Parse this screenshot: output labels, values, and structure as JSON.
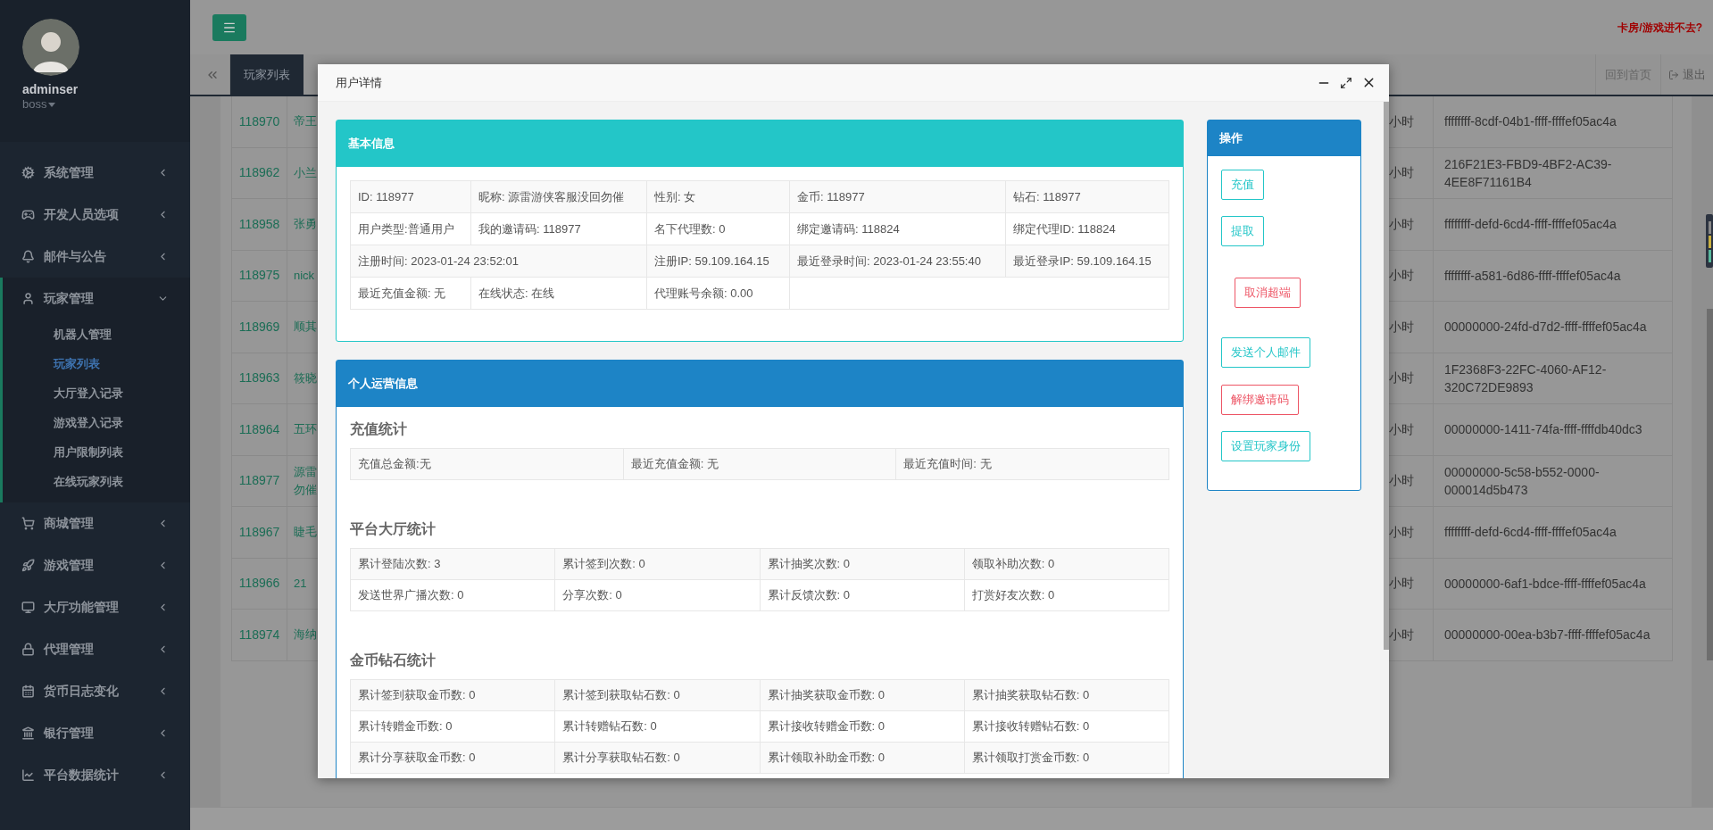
{
  "sidebar": {
    "user": {
      "name": "adminser",
      "role": "boss"
    },
    "menu": [
      {
        "label": "系统管理",
        "expanded": false
      },
      {
        "label": "开发人员选项",
        "expanded": false
      },
      {
        "label": "邮件与公告",
        "expanded": false
      },
      {
        "label": "玩家管理",
        "expanded": true,
        "children": [
          {
            "label": "机器人管理",
            "selected": false
          },
          {
            "label": "玩家列表",
            "selected": true
          },
          {
            "label": "大厅登入记录",
            "selected": false
          },
          {
            "label": "游戏登入记录",
            "selected": false
          },
          {
            "label": "用户限制列表",
            "selected": false
          },
          {
            "label": "在线玩家列表",
            "selected": false
          }
        ]
      },
      {
        "label": "商城管理",
        "expanded": false
      },
      {
        "label": "游戏管理",
        "expanded": false
      },
      {
        "label": "大厅功能管理",
        "expanded": false
      },
      {
        "label": "代理管理",
        "expanded": false
      },
      {
        "label": "货币日志变化",
        "expanded": false
      },
      {
        "label": "银行管理",
        "expanded": false
      },
      {
        "label": "平台数据统计",
        "expanded": false
      }
    ]
  },
  "header": {
    "alert_link": "卡房/游戏进不去?"
  },
  "tab_bar": {
    "tabs": [
      {
        "label": "玩家列表",
        "selected": true
      }
    ],
    "home": "回到首页",
    "logout": "退出"
  },
  "table": {
    "rows": [
      {
        "id": "118970",
        "name": [
          "帝王"
        ],
        "column_3": "小时",
        "column_4": "ffffffff-8cdf-04b1-ffff-ffffef05ac4a"
      },
      {
        "id": "118962",
        "name": [
          "小兰"
        ],
        "column_3": "小时",
        "column_4": "216F21E3-FBD9-4BF2-AC39-4EE8F71161B4"
      },
      {
        "id": "118958",
        "name": [
          "张勇"
        ],
        "column_3": "小时",
        "column_4": "ffffffff-defd-6cd4-ffff-ffffef05ac4a"
      },
      {
        "id": "118975",
        "name": [
          "nick"
        ],
        "column_3": "小时",
        "column_4": "ffffffff-a581-6d86-ffff-ffffef05ac4a"
      },
      {
        "id": "118969",
        "name": [
          "顺其"
        ],
        "column_3": "小时",
        "column_4": "00000000-24fd-d7d2-ffff-ffffef05ac4a"
      },
      {
        "id": "118963",
        "name": [
          "筱晓"
        ],
        "column_3": "小时",
        "column_4": "1F2368F3-22FC-4060-AF12-320C72DE9893"
      },
      {
        "id": "118964",
        "name": [
          "五环"
        ],
        "column_3": "小时",
        "column_4": "00000000-1411-74fa-ffff-ffffdb40dc3"
      },
      {
        "id": "118977",
        "name": [
          "源雷",
          "勿催"
        ],
        "column_3": "小时",
        "column_4": "00000000-5c58-b552-0000-000014d5b473"
      },
      {
        "id": "118967",
        "name": [
          "睫毛"
        ],
        "column_3": "小时",
        "column_4": "ffffffff-defd-6cd4-ffff-ffffef05ac4a"
      },
      {
        "id": "118966",
        "name": [
          "21"
        ],
        "column_3": "小时",
        "column_4": "00000000-6af1-bdce-ffff-ffffef05ac4a"
      },
      {
        "id": "118974",
        "name": [
          "海纳"
        ],
        "column_3": "小时",
        "column_4": "00000000-00ea-b3b7-ffff-ffffef05ac4a"
      }
    ]
  },
  "modal": {
    "title": "用户详情",
    "basic_info": {
      "title": "基本信息",
      "rows": [
        [
          {
            "text": "ID: 118977"
          },
          {
            "text": "昵称: 源雷游侠客服没回勿催"
          },
          {
            "text": "性别: 女"
          },
          {
            "text": "金币: 118977"
          },
          {
            "text": "钻石: 118977"
          }
        ],
        [
          {
            "text": "用户类型:普通用户"
          },
          {
            "text": "我的邀请码: 118977"
          },
          {
            "text": "名下代理数: 0"
          },
          {
            "text": "绑定邀请码: 118824"
          },
          {
            "text": "绑定代理ID: 118824"
          }
        ],
        [
          {
            "text": "注册时间: 2023-01-24 23:52:01",
            "colspan": 2
          },
          {
            "text": "注册IP: 59.109.164.15"
          },
          {
            "text": "最近登录时间: 2023-01-24 23:55:40"
          },
          {
            "text": "最近登录IP: 59.109.164.15"
          }
        ],
        [
          {
            "text": "最近充值金额: 无"
          },
          {
            "text": "在线状态: 在线"
          },
          {
            "text": "代理账号余额: 0.00"
          }
        ]
      ]
    },
    "operations": {
      "title": "个人运营信息",
      "sections": [
        {
          "title": "充值统计",
          "rows": [
            [
              "充值总金额:无",
              "最近充值金额: 无",
              "最近充值时间: 无"
            ]
          ]
        },
        {
          "title": "平台大厅统计",
          "rows": [
            [
              "累计登陆次数: 3",
              "累计签到次数: 0",
              "累计抽奖次数: 0",
              "领取补助次数: 0"
            ],
            [
              "发送世界广播次数: 0",
              "分享次数: 0",
              "累计反馈次数: 0",
              "打赏好友次数: 0"
            ]
          ]
        },
        {
          "title": "金币钻石统计",
          "rows": [
            [
              "累计签到获取金币数: 0",
              "累计签到获取钻石数: 0",
              "累计抽奖获取金币数: 0",
              "累计抽奖获取钻石数: 0"
            ],
            [
              "累计转赠金币数: 0",
              "累计转赠钻石数: 0",
              "累计接收转赠金币数: 0",
              "累计接收转赠钻石数: 0"
            ],
            [
              "累计分享获取金币数: 0",
              "累计分享获取钻石数: 0",
              "累计领取补助金币数: 0",
              "累计领取打赏金币数: 0"
            ]
          ]
        }
      ]
    },
    "actions": {
      "title": "操作",
      "buttons": [
        {
          "label": "充值",
          "kind": "info"
        },
        {
          "label": "提取",
          "kind": "info"
        },
        {
          "label": "取消超端",
          "kind": "danger"
        },
        {
          "label": "发送个人邮件",
          "kind": "info"
        },
        {
          "label": "解绑邀请码",
          "kind": "danger"
        },
        {
          "label": "设置玩家身份",
          "kind": "info"
        }
      ]
    }
  }
}
